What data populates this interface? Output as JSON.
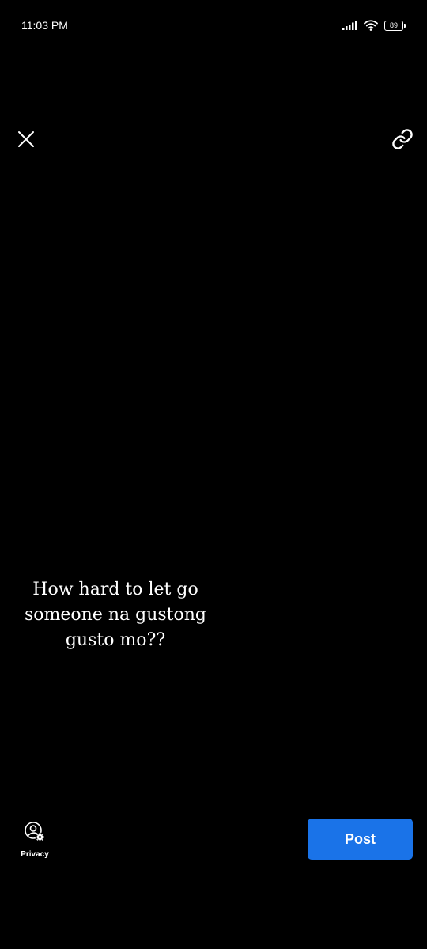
{
  "status_bar": {
    "time": "11:03 PM",
    "battery_level": "89"
  },
  "icons": {
    "close": "close-icon",
    "link": "link-icon",
    "privacy": "privacy-settings-icon",
    "signal": "signal-icon",
    "wifi": "wifi-icon",
    "battery": "battery-icon"
  },
  "post": {
    "text": "How hard to let go someone na gustong gusto mo??"
  },
  "bottom_bar": {
    "privacy_label": "Privacy",
    "post_label": "Post"
  },
  "colors": {
    "background": "#000000",
    "accent": "#1a73e8",
    "text": "#ffffff"
  }
}
